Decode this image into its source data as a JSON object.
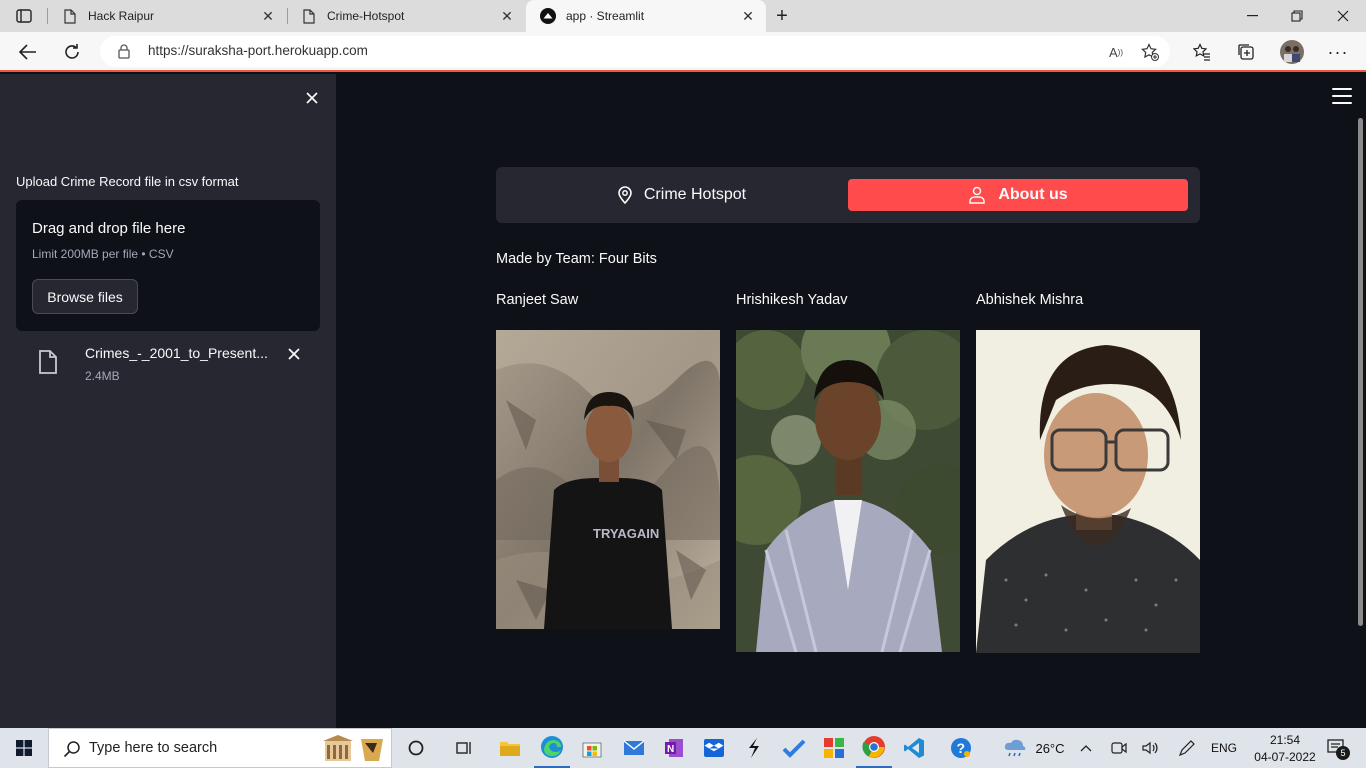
{
  "browser": {
    "tabs": [
      {
        "title": "Hack Raipur",
        "icon": "page-icon"
      },
      {
        "title": "Crime-Hotspot",
        "icon": "page-icon"
      },
      {
        "title": "app · Streamlit",
        "icon": "streamlit-icon"
      }
    ],
    "url": "https://suraksha-port.herokuapp.com",
    "accent": "#f0573d"
  },
  "sidebar": {
    "uploader_label": "Upload Crime Record file in csv format",
    "dropzone_title": "Drag and drop file here",
    "dropzone_limit": "Limit 200MB per file • CSV",
    "browse_label": "Browse files",
    "file_name": "Crimes_-_2001_to_Present...",
    "file_size": "2.4MB"
  },
  "main": {
    "nav": [
      {
        "label": "Crime Hotspot",
        "icon": "location-pin-icon",
        "selected": false
      },
      {
        "label": "About us",
        "icon": "user-icon",
        "selected": true
      }
    ],
    "team_line": "Made by Team: Four Bits",
    "members": [
      {
        "name": "Ranjeet Saw",
        "shirt_text": "TRYAGAIN"
      },
      {
        "name": "Hrishikesh Yadav"
      },
      {
        "name": "Abhishek Mishra"
      }
    ],
    "accent": "#ff4b4b"
  },
  "taskbar": {
    "search_placeholder": "Type here to search",
    "weather": "26°C",
    "language": "ENG",
    "time": "21:54",
    "date": "04-07-2022",
    "notification_count": "5"
  }
}
